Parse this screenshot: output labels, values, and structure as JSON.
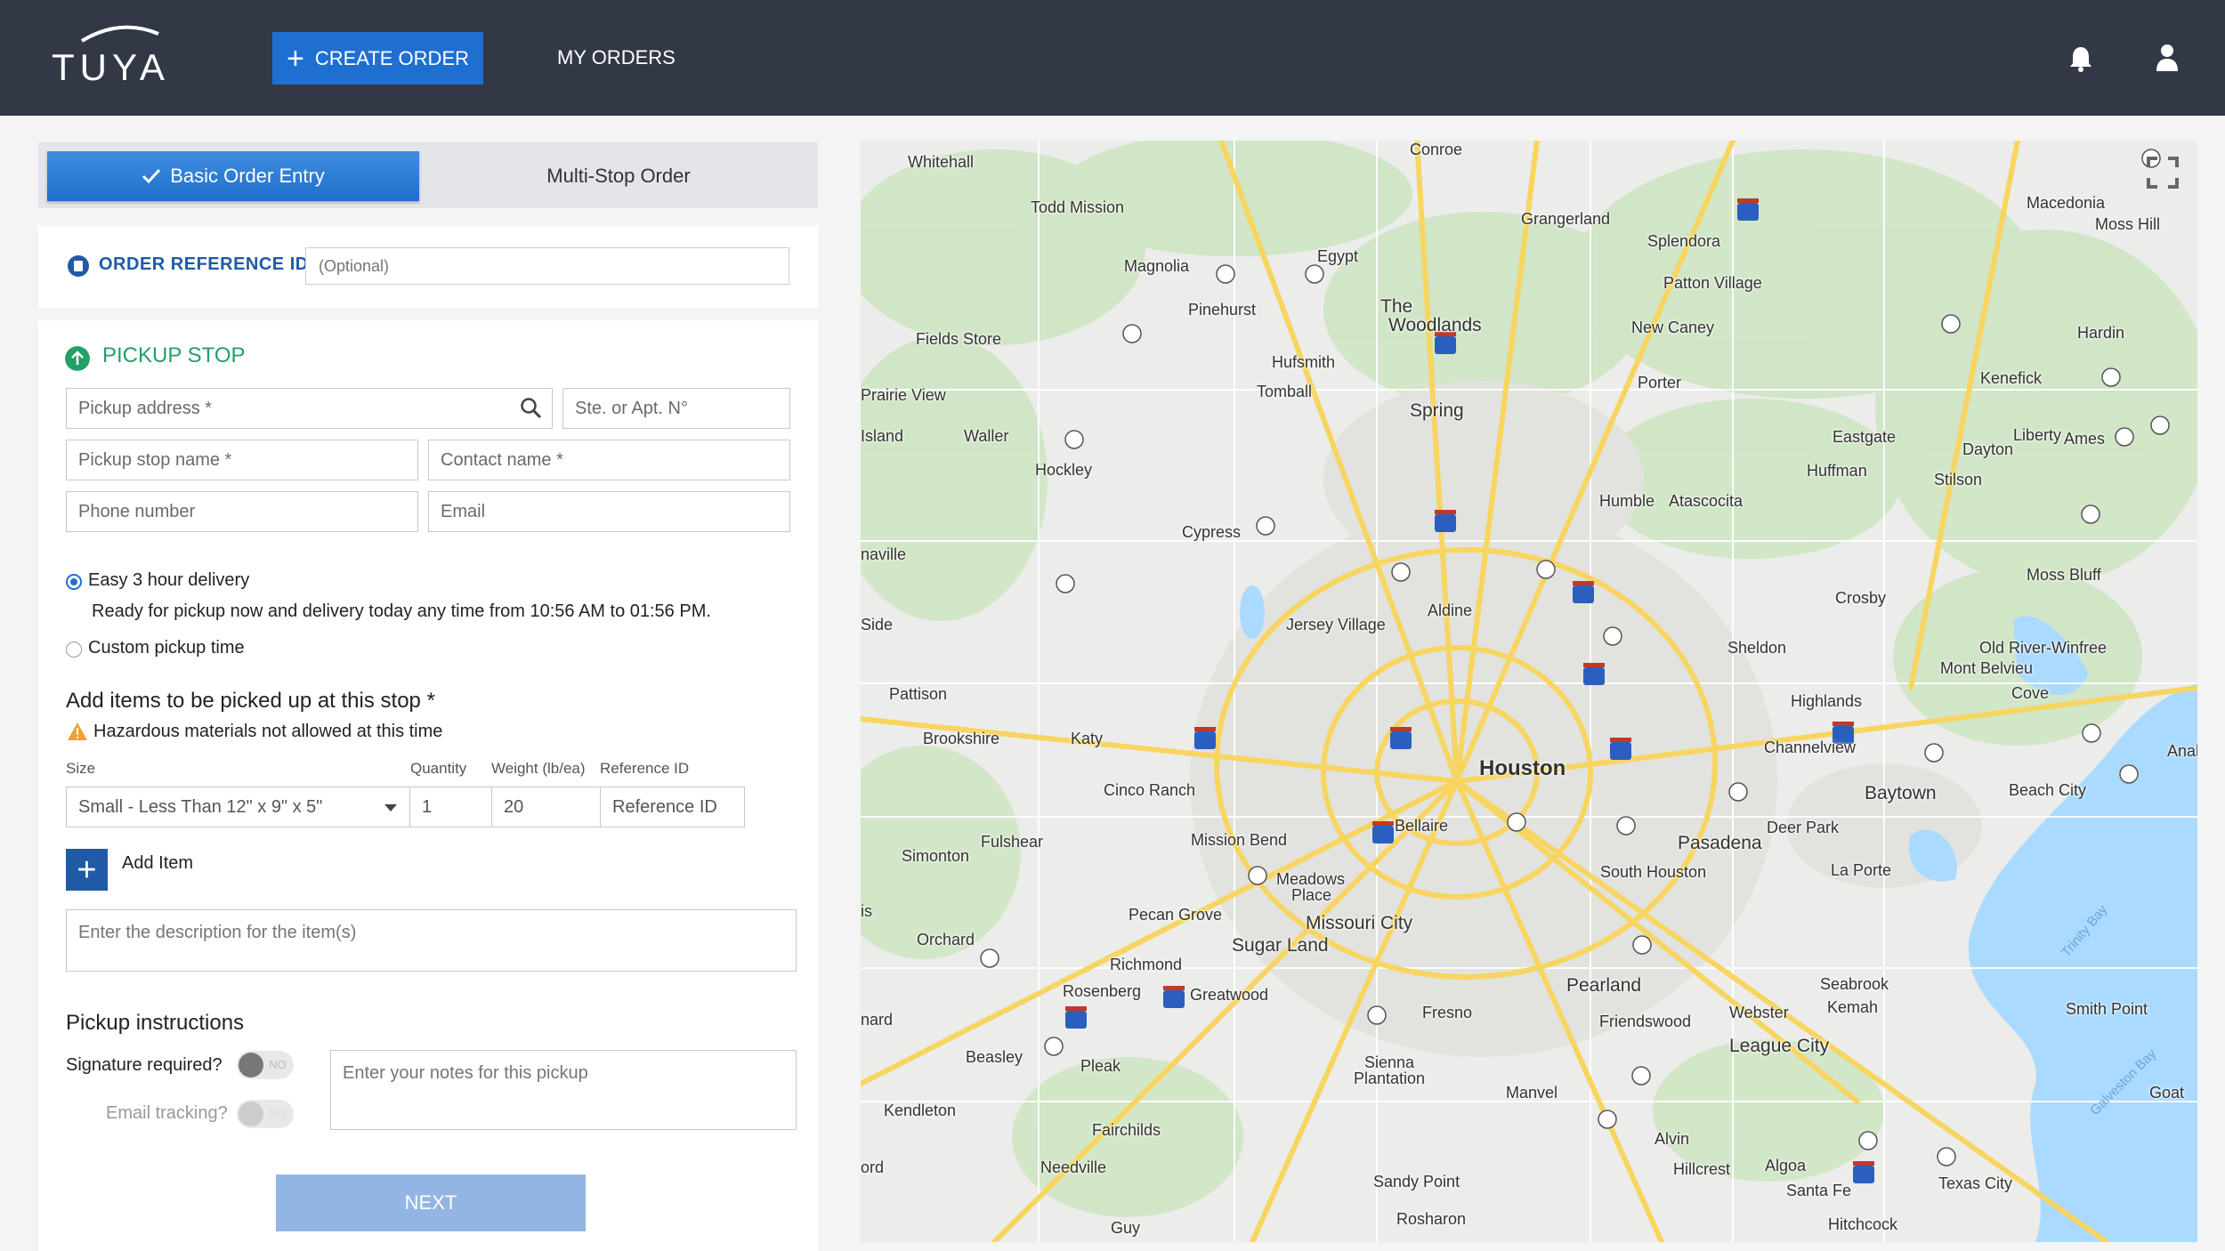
{
  "header": {
    "logo": "TUYA",
    "create_order": "CREATE ORDER",
    "my_orders": "MY ORDERS",
    "icons": [
      "bell-icon",
      "user-icon"
    ]
  },
  "tabs": {
    "basic": "Basic Order Entry",
    "multi": "Multi-Stop Order"
  },
  "reference": {
    "label": "ORDER REFERENCE ID",
    "placeholder": "(Optional)"
  },
  "pickup": {
    "title": "PICKUP STOP",
    "address_placeholder": "Pickup address *",
    "suite_placeholder": "Ste. or Apt. N°",
    "stop_name_placeholder": "Pickup stop name *",
    "contact_placeholder": "Contact name *",
    "phone_placeholder": "Phone number",
    "email_placeholder": "Email",
    "option_easy": "Easy 3 hour delivery",
    "easy_desc": "Ready for pickup now and delivery today any time from 10:56 AM to 01:56 PM.",
    "option_custom": "Custom pickup time",
    "items_title": "Add items to be picked up at this stop *",
    "hazard_warning": "Hazardous materials not allowed at this time",
    "col_size": "Size",
    "col_quantity": "Quantity",
    "col_weight": "Weight (lb/ea)",
    "col_reference": "Reference ID",
    "size_value": "Small - Less Than 12\" x 9\" x 5\"",
    "quantity_value": "1",
    "weight_value": "20",
    "reference_placeholder": "Reference ID",
    "add_item": "Add Item",
    "description_placeholder": "Enter the description for the item(s)",
    "instructions_title": "Pickup instructions",
    "signature_label": "Signature required?",
    "email_tracking_label": "Email tracking?",
    "toggle_no": "NO",
    "notes_placeholder": "Enter your notes for this pickup",
    "next": "NEXT"
  },
  "map": {
    "labels": [
      "Conroe",
      "Whitehall",
      "Todd Mission",
      "Grangerland",
      "Macedonia",
      "Moss Hill",
      "Egypt",
      "Magnolia",
      "Splendora",
      "Pinehurst",
      "The",
      "Woodlands",
      "Patton Village",
      "Fields Store",
      "Hufsmith",
      "New Caney",
      "Hardin",
      "Prairie View",
      "Tomball",
      "Porter",
      "Kenefick",
      "Waller",
      "Spring",
      "Eastgate",
      "Liberty",
      "Ames",
      "Dayton",
      "Hockley",
      "Huffman",
      "Stilson",
      "Humble",
      "Atascocita",
      "Cypress",
      "Moss Bluff",
      "Crosby",
      "Aldine",
      "Jersey Village",
      "Sheldon",
      "Old River-Winfree",
      "Mont Belvieu",
      "Pattison",
      "Highlands",
      "Cove",
      "Brookshire",
      "Katy",
      "Channelview",
      "Houston",
      "Anahu",
      "Cinco Ranch",
      "Baytown",
      "Beach City",
      "Bellaire",
      "Deer Park",
      "Fulshear",
      "Mission Bend",
      "Pasadena",
      "Simonton",
      "South Houston",
      "La Porte",
      "Meadows",
      "Place",
      "Pecan Grove",
      "Missouri City",
      "Orchard",
      "Sugar Land",
      "Richmond",
      "Pearland",
      "Seabrook",
      "Kemah",
      "Rosenberg",
      "Greatwood",
      "Fresno",
      "Friendswood",
      "Webster",
      "Smith Point",
      "League City",
      "Beasley",
      "Pleak",
      "Sienna",
      "Plantation",
      "Manvel",
      "Goat",
      "Kendleton",
      "Fairchilds",
      "Alvin",
      "Needville",
      "Hillcrest",
      "Algoa",
      "Santa Fe",
      "Texas City",
      "Sandy Point",
      "Rosharon",
      "Guy",
      "Hitchcock",
      "Trinity Bay",
      "Galveston Bay",
      "Side",
      "Island",
      "naville",
      "nard",
      "ord",
      "is"
    ],
    "fullscreen_icon": "fullscreen-icon"
  }
}
